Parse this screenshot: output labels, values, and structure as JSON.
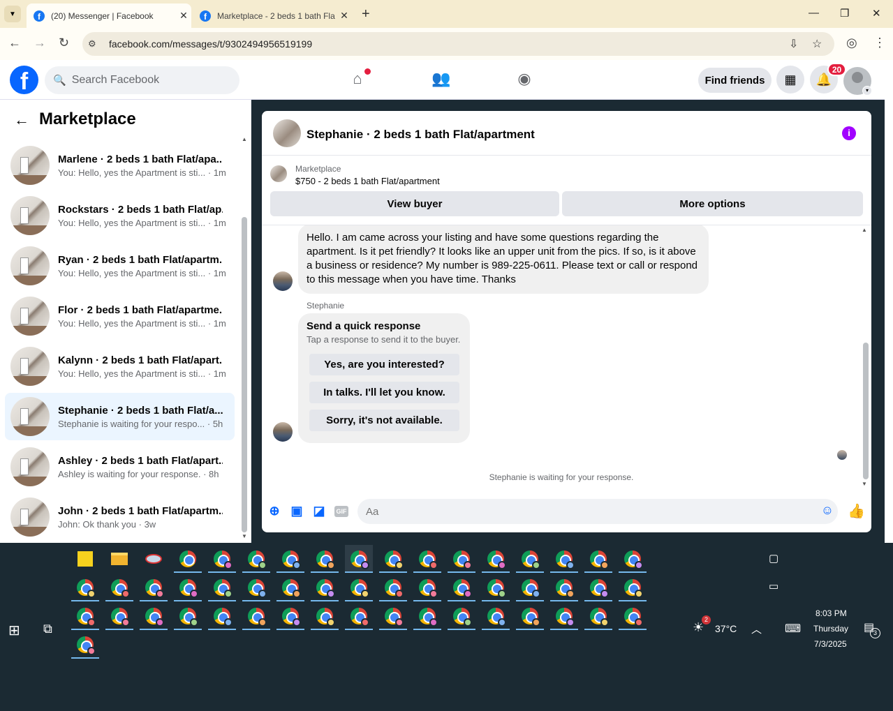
{
  "browser": {
    "tabs": [
      {
        "title": "(20) Messenger | Facebook",
        "close": "✕"
      },
      {
        "title": "Marketplace - 2 beds 1 bath Fla",
        "close": "✕"
      }
    ],
    "new_tab": "+",
    "url": "facebook.com/messages/t/9302494956519199",
    "window_controls": [
      "—",
      "❐",
      "✕"
    ]
  },
  "fb_header": {
    "logo": "f",
    "search_placeholder": "Search Facebook",
    "find_friends": "Find friends",
    "notification_count": "20"
  },
  "sidebar": {
    "back": "←",
    "title": "Marketplace",
    "items": [
      {
        "title": "Marlene · 2 beds 1 bath Flat/apa...",
        "sub": "You: Hello, yes the Apartment is sti... · 1m"
      },
      {
        "title": "Rockstars · 2 beds 1 bath Flat/ap...",
        "sub": "You: Hello, yes the Apartment is sti... · 1m"
      },
      {
        "title": "Ryan · 2 beds 1 bath Flat/apartm...",
        "sub": "You: Hello, yes the Apartment is sti... · 1m"
      },
      {
        "title": "Flor · 2 beds 1 bath Flat/apartme...",
        "sub": "You: Hello, yes the Apartment is sti... · 1m"
      },
      {
        "title": "Kalynn · 2 beds 1 bath Flat/apart...",
        "sub": "You: Hello, yes the Apartment is sti... · 1m"
      },
      {
        "title": "Stephanie · 2 beds 1 bath Flat/a...",
        "sub": "Stephanie is waiting for your respo... · 5h"
      },
      {
        "title": "Ashley · 2 beds 1 bath Flat/apart...",
        "sub": "Ashley is waiting for your response. · 8h"
      },
      {
        "title": "John · 2 beds 1 bath Flat/apartm...",
        "sub": "John: Ok thank you · 3w"
      }
    ]
  },
  "chat": {
    "title": "Stephanie · 2 beds 1 bath Flat/apartment",
    "info_icon": "i",
    "marketplace_label": "Marketplace",
    "listing": "$750 - 2 beds 1 bath Flat/apartment",
    "view_buyer": "View buyer",
    "more_options": "More options",
    "message": "Hello. I am came across your listing and have some questions regarding the apartment. Is it pet friendly? It looks like an upper unit from the pics. If so, is it above a business or residence? My number is 989-225-0611. Please text or call or respond to this message when you have time. Thanks",
    "sender_name": "Stephanie",
    "quick_title": "Send a quick response",
    "quick_sub": "Tap a response to send it to the buyer.",
    "quick_options": [
      "Yes, are you interested?",
      "In talks. I'll let you know.",
      "Sorry, it's not available."
    ],
    "waiting": "Stephanie is waiting for your response.",
    "composer_placeholder": "Aa",
    "gif": "GIF"
  },
  "taskbar": {
    "temperature": "37°C",
    "weather_badge": "2",
    "time": "8:03 PM",
    "day": "Thursday",
    "date": "7/3/2025",
    "notifications": "3"
  },
  "colors": {
    "accent": "#0866ff",
    "info": "#a100ff",
    "badge": "#e41e3f",
    "taskbar": "#1b2a33"
  }
}
